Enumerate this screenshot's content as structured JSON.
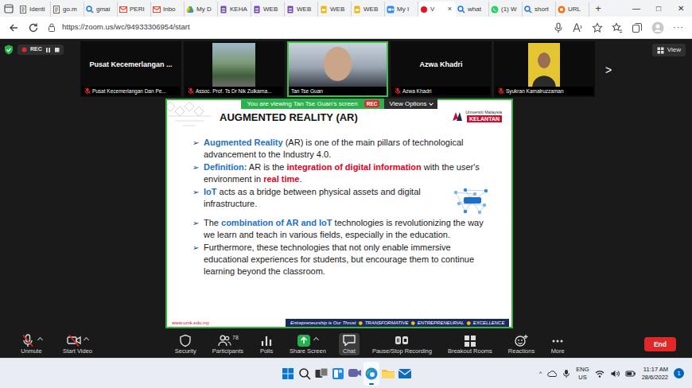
{
  "browser": {
    "tabs": [
      {
        "label": "Identi",
        "kind": "doc",
        "selected": false
      },
      {
        "label": "go.m",
        "kind": "doc",
        "selected": false
      },
      {
        "label": "gmai",
        "kind": "search",
        "selected": false
      },
      {
        "label": "PERI",
        "kind": "gmail",
        "selected": false
      },
      {
        "label": "Inbo",
        "kind": "gmail",
        "selected": false
      },
      {
        "label": "My D",
        "kind": "drive",
        "selected": false
      },
      {
        "label": "KEHA",
        "kind": "form",
        "selected": false
      },
      {
        "label": "WEB",
        "kind": "form",
        "selected": false
      },
      {
        "label": "WEB",
        "kind": "form",
        "selected": false
      },
      {
        "label": "WEB",
        "kind": "slides",
        "selected": false
      },
      {
        "label": "WEB",
        "kind": "slides",
        "selected": false
      },
      {
        "label": "My I",
        "kind": "zoom",
        "selected": false
      },
      {
        "label": "V",
        "kind": "recording",
        "selected": true
      },
      {
        "label": "what",
        "kind": "search",
        "selected": false
      },
      {
        "label": "(1) W",
        "kind": "whatsapp",
        "selected": false
      },
      {
        "label": "short",
        "kind": "search",
        "selected": false
      },
      {
        "label": "URL",
        "kind": "url",
        "selected": false
      }
    ],
    "close_tab": "×",
    "new_tab": "+",
    "window_controls": [
      "—",
      "□",
      "✕"
    ],
    "address": "https://zoom.us/wc/94933306954/start",
    "menu": "···"
  },
  "meeting": {
    "recording": {
      "label": "REC",
      "on": true
    },
    "view_button": "View",
    "tiles": [
      {
        "name": "Pusat Kecemerlangan ...",
        "caption": "Pusat Kecemerlangan Dan Pe...",
        "kind": "name",
        "muted": true,
        "speaking": false
      },
      {
        "caption": "Assoc. Prof. Ts Dr Nik Zulkarna...",
        "kind": "photo",
        "muted": true,
        "speaking": false
      },
      {
        "caption": "Tan Tse Guan",
        "kind": "video",
        "muted": false,
        "speaking": true
      },
      {
        "name": "Azwa Khadri",
        "caption": "Azwa Khadri",
        "kind": "name",
        "muted": true,
        "speaking": false
      },
      {
        "caption": "Syukran Kamalruzzaman",
        "kind": "portrait",
        "muted": true,
        "speaking": false
      }
    ],
    "next": ">",
    "banner": {
      "text": "You are viewing Tan Tse Guan's screen",
      "rec": "REC",
      "options": "View Options"
    },
    "slide": {
      "title": "AUGMENTED REALITY (AR)",
      "logo": {
        "line1": "Universiti Malaysia",
        "line2": "KELANTAN"
      },
      "bullet": "➢",
      "points": [
        {
          "has_figure": false,
          "segments": [
            {
              "text": "Augmented Reality",
              "kind": "term"
            },
            {
              "text": " (AR) is one of the main pillars of technological advancement to the Industry 4.0.",
              "kind": "plain"
            }
          ]
        },
        {
          "has_figure": false,
          "segments": [
            {
              "text": "Definition:",
              "kind": "term"
            },
            {
              "text": " AR is the ",
              "kind": "plain"
            },
            {
              "text": "integration of digital information",
              "kind": "alert"
            },
            {
              "text": " with the user's environment in ",
              "kind": "plain"
            },
            {
              "text": "real time",
              "kind": "alert"
            },
            {
              "text": ".",
              "kind": "plain"
            }
          ]
        },
        {
          "has_figure": true,
          "segments": [
            {
              "text": "IoT",
              "kind": "term"
            },
            {
              "text": " acts as a bridge between physical assets and digital infrastructure.",
              "kind": "plain"
            }
          ]
        },
        {
          "has_figure": false,
          "segments": [
            {
              "text": "The ",
              "kind": "plain"
            },
            {
              "text": "combination of AR and IoT",
              "kind": "term"
            },
            {
              "text": " technologies is revolutionizing the way we learn and teach in various fields, especially in the education.",
              "kind": "plain"
            }
          ]
        },
        {
          "has_figure": false,
          "segments": [
            {
              "text": "Furthermore, these technologies that not only enable immersive educational experiences for students, but encourage them to continue learning beyond the classroom.",
              "kind": "plain"
            }
          ]
        }
      ],
      "footer": {
        "url": "www.umk.edu.my",
        "motto": "Entrepreneurship is Our Thrust",
        "separator": "●",
        "values": [
          "TRANSFORMATIVE",
          "ENTREPRENEURIAL",
          "EXCELLENCE"
        ]
      }
    },
    "toolbar": {
      "items": [
        {
          "label": "Unmute",
          "kind": "mic",
          "muted": true,
          "caret": true,
          "selected": false
        },
        {
          "label": "Start Video",
          "kind": "camera",
          "muted": true,
          "caret": true,
          "selected": false
        },
        {
          "label": "Security",
          "kind": "security",
          "caret": false,
          "selected": false
        },
        {
          "label": "Participants",
          "kind": "participants",
          "count": "78",
          "caret": false,
          "selected": false
        },
        {
          "label": "Polls",
          "kind": "polls",
          "caret": false,
          "selected": false
        },
        {
          "label": "Share Screen",
          "kind": "share",
          "caret": true,
          "selected": false
        },
        {
          "label": "Chat",
          "kind": "chat",
          "caret": false,
          "selected": true
        },
        {
          "label": "Pause/Stop Recording",
          "kind": "record",
          "caret": false,
          "selected": false
        },
        {
          "label": "Breakout Rooms",
          "kind": "breakout",
          "caret": false,
          "selected": false
        },
        {
          "label": "Reactions",
          "kind": "reactions",
          "caret": false,
          "selected": false
        },
        {
          "label": "More",
          "kind": "more",
          "caret": false,
          "selected": false
        }
      ],
      "end": "End"
    }
  },
  "taskbar": {
    "apps": [
      {
        "kind": "start",
        "selected": false
      },
      {
        "kind": "search",
        "selected": false
      },
      {
        "kind": "taskview",
        "selected": false
      },
      {
        "kind": "widgets",
        "selected": false
      },
      {
        "kind": "chat",
        "selected": false
      },
      {
        "kind": "edge",
        "selected": true
      },
      {
        "kind": "explorer",
        "selected": false
      },
      {
        "kind": "mail",
        "selected": false
      }
    ],
    "tray": {
      "caret": "^",
      "language": "ENG",
      "region": "US",
      "time": "11:17 AM",
      "date": "28/6/2022",
      "notifications": "1"
    }
  }
}
